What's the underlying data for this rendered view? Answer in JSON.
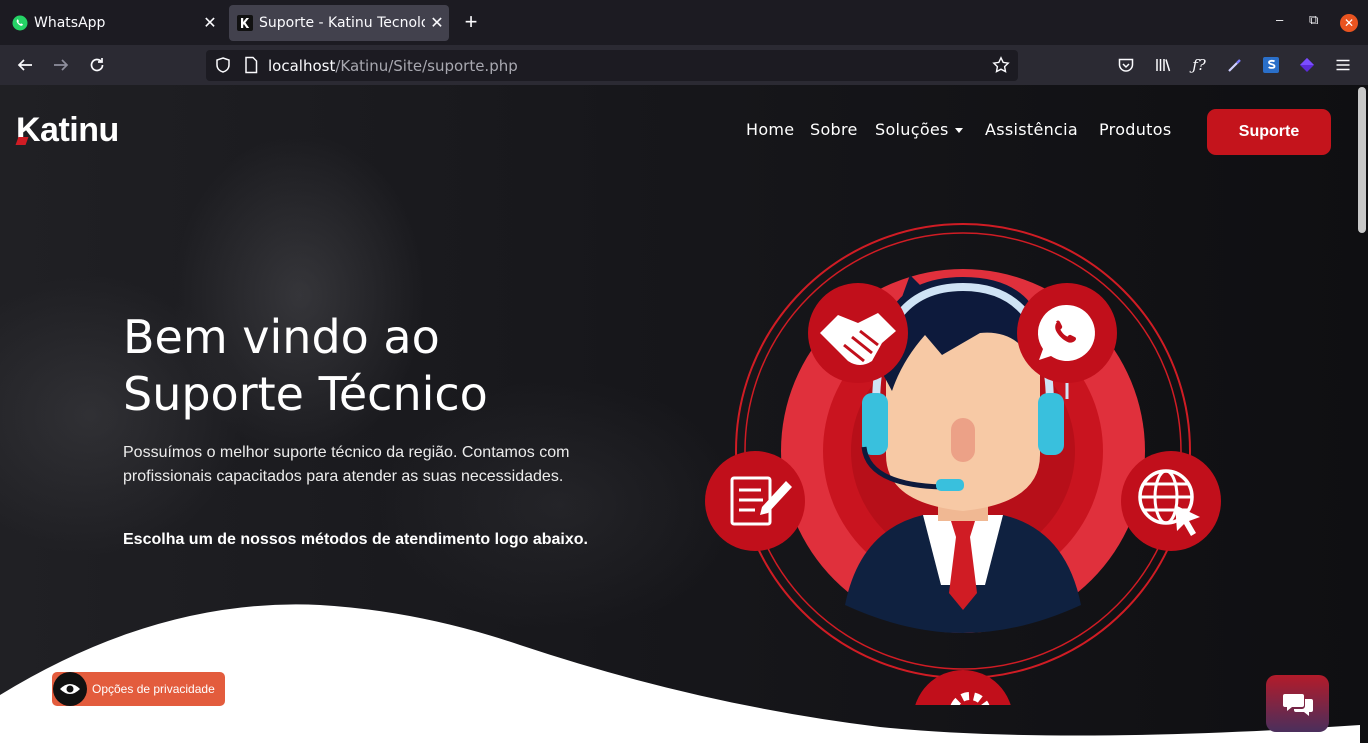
{
  "browser": {
    "tabs": [
      {
        "title": "WhatsApp",
        "active": false,
        "favicon": "whatsapp-icon"
      },
      {
        "title": "Suporte - Katinu Tecnologia",
        "active": true,
        "favicon": "katinu-favicon"
      }
    ],
    "url": {
      "host": "localhost",
      "path": "/Katinu/Site/suporte.php"
    }
  },
  "site": {
    "logo": "Katinu",
    "nav": [
      {
        "label": "Home"
      },
      {
        "label": "Sobre"
      },
      {
        "label": "Soluções",
        "dropdown": true
      },
      {
        "label": "Assistência"
      },
      {
        "label": "Produtos"
      }
    ],
    "cta_button": "Suporte",
    "hero": {
      "title_line1": "Bem vindo ao",
      "title_line2": "Suporte Técnico",
      "lead": "Possuímos o melhor suporte técnico da região. Contamos com profissionais capacitados para atender as suas necessidades.",
      "cta_text": "Escolha um de nossos métodos de atendimento logo abaixo."
    },
    "support_icons": [
      "handshake-icon",
      "whatsapp-icon",
      "form-icon",
      "web-icon",
      "tools-icon"
    ],
    "privacy_button": "Opções de privacidade",
    "chat_button": "chat-icon"
  },
  "colors": {
    "brand_red": "#c4141c",
    "dark_bg": "#121216",
    "privacy": "#e35c3d"
  }
}
